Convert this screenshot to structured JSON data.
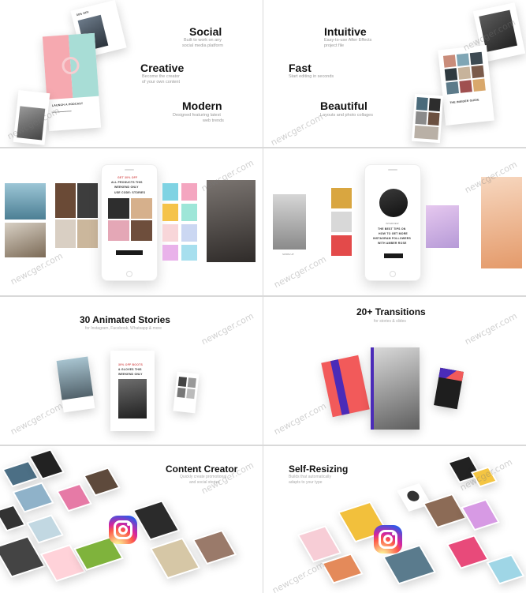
{
  "features_left": [
    {
      "title": "Social",
      "subtitle": [
        "Built to work on any",
        "social media platform"
      ]
    },
    {
      "title": "Creative",
      "subtitle": [
        "Become the creator",
        "of your own content"
      ]
    },
    {
      "title": "Modern",
      "subtitle": [
        "Designed featuring latest",
        "web trends"
      ]
    }
  ],
  "features_right": [
    {
      "title": "Intuitive",
      "subtitle": [
        "Easy-to-use After Effects",
        "project file"
      ]
    },
    {
      "title": "Fast",
      "subtitle": [
        "Start editing in seconds",
        ""
      ]
    },
    {
      "title": "Beautiful",
      "subtitle": [
        "Layouts and photo collages",
        ""
      ]
    }
  ],
  "mock_text": {
    "podcast": "LAUNCH A PODCAST",
    "inside_guide": "THE INSIDER GUIDE",
    "sale_lines": [
      "GET 30% OFF",
      "ALL PRODUCTS THIS",
      "WEEKEND ONLY"
    ],
    "use_code": "USE CODE: STORIES",
    "tips_lines": [
      "THE BEST TIPS ON",
      "HOW TO GET MORE",
      "INSTAGRAM FOLLOWERS",
      "WITH AMBER ROSE"
    ],
    "interview": "INTERVIEW",
    "boots_lines": [
      "30% OFF BOOTS",
      "& GLOVES THIS",
      "WEEKEND ONLY"
    ],
    "swipe_up": "SWIPE UP"
  },
  "animated_stories": {
    "title": "30 Animated Stories",
    "subtitle": "for Instagram, Facebook, Whatsapp & more"
  },
  "transitions": {
    "title": "20+ Transitions",
    "subtitle": "for stories & slides"
  },
  "content_creator": {
    "title": "Content Creator",
    "subtitle": [
      "Quickly create promotional",
      "and social stories"
    ]
  },
  "self_resizing": {
    "title": "Self-Resizing",
    "subtitle": [
      "Builds that automatically",
      "adapts to your type"
    ]
  },
  "watermark_text": "newcger.com",
  "colors": {
    "pink": "#f6a9b0",
    "mint": "#a8ddd6",
    "instagram_gradient_start": "#fd5949",
    "instagram_gradient_end": "#285AEB",
    "purple_stripe": "#4b2bb8",
    "coral": "#f25a5a"
  }
}
